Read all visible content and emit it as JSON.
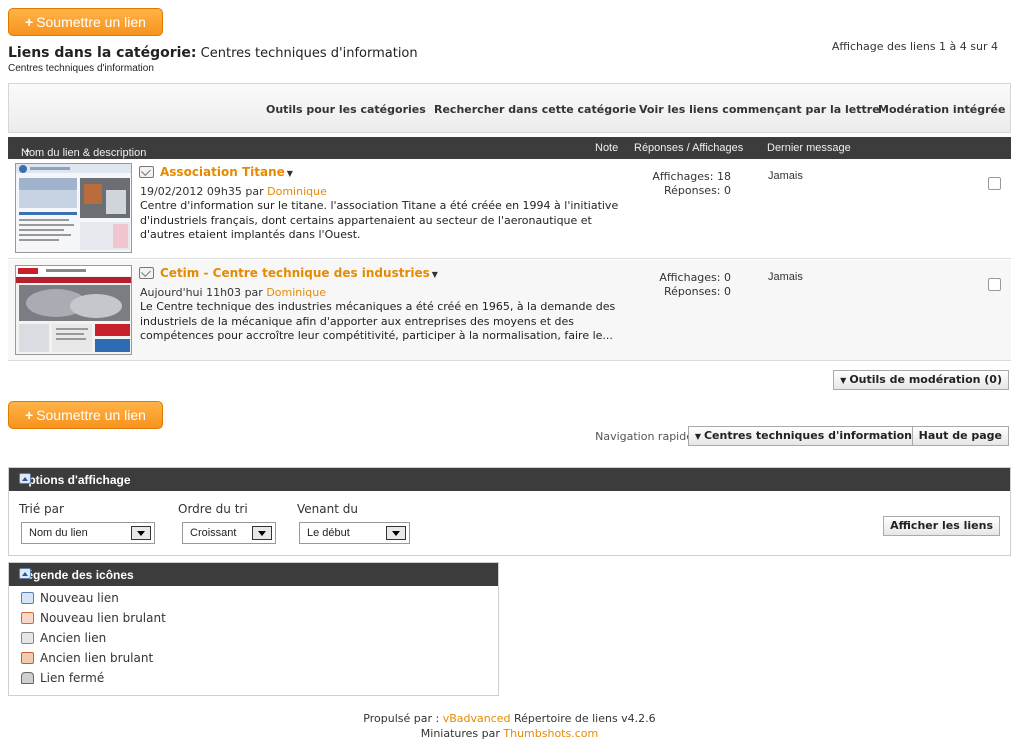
{
  "header": {
    "submit_label": "Soumettre un lien",
    "category_prefix": "Liens dans la catégorie:",
    "category_name": "Centres techniques d'information",
    "category_sub": "Centres techniques d'information",
    "count_text": "Affichage des liens 1 à 4 sur 4"
  },
  "toolbar": {
    "tools": "Outils pour les catégories",
    "search": "Rechercher dans cette catégorie",
    "letter": "Voir les liens commençant par la lettre",
    "moderation": "Modération intégrée"
  },
  "table": {
    "col_name": "Nom du lien & description",
    "col_note": "Note",
    "col_replies": "Réponses / Affichages",
    "col_last": "Dernier message"
  },
  "links": [
    {
      "title": "Association Titane",
      "date": "19/02/2012 09h35",
      "by": "par",
      "user": "Dominique",
      "description": "Centre d'information sur le titane. l'association Titane a été créée en 1994 à l'initiative d'industriels français, dont certains appartenaient au secteur de l'aeronautique et d'autres etaient implantés dans l'Ouest.",
      "views": "Affichages: 18",
      "replies": "Réponses: 0",
      "last": "Jamais"
    },
    {
      "title": "Cetim - Centre technique des industries",
      "date": "Aujourd'hui 11h03",
      "by": "par",
      "user": "Dominique",
      "description": "Le Centre technique des industries mécaniques a été créé en 1965, à la demande des industriels de la mécanique afin d'apporter aux entreprises des moyens et des compétences pour accroître leur compétitivité, participer à la normalisation, faire le...",
      "views": "Affichages: 0",
      "replies": "Réponses: 0",
      "last": "Jamais"
    }
  ],
  "moderation_tools": "Outils de modération (0)",
  "navigation": {
    "label": "Navigation rapide",
    "current": "Centres techniques d'information",
    "top": "Haut de page"
  },
  "display_options": {
    "title": "Options d'affichage",
    "sort_by_label": "Trié par",
    "sort_by_value": "Nom du lien",
    "order_label": "Ordre du tri",
    "order_value": "Croissant",
    "from_label": "Venant du",
    "from_value": "Le début",
    "show_button": "Afficher les liens"
  },
  "legend": {
    "title": "Légende des icônes",
    "items": [
      "Nouveau lien",
      "Nouveau lien brulant",
      "Ancien lien",
      "Ancien lien brulant",
      "Lien fermé"
    ]
  },
  "footer": {
    "powered_prefix": "Propulsé par :",
    "powered_link": "vBadvanced",
    "powered_suffix": "Répertoire de liens v4.2.6",
    "thumbs_prefix": "Miniatures par",
    "thumbs_link": "Thumbshots.com"
  },
  "colors": {
    "accent": "#f7931e",
    "link": "#e68a00",
    "header_bar": "#3c3c3c"
  }
}
